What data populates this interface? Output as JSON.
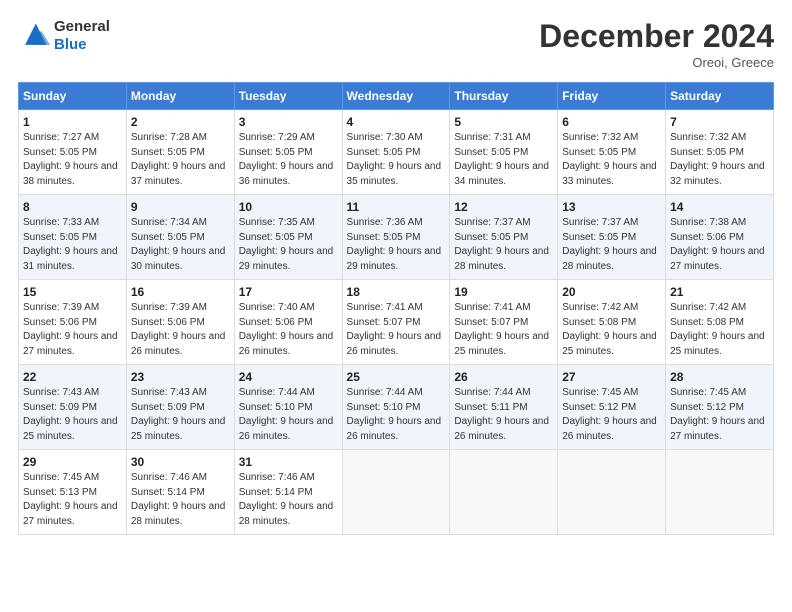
{
  "header": {
    "logo_line1": "General",
    "logo_line2": "Blue",
    "month": "December 2024",
    "location": "Oreoi, Greece"
  },
  "weekdays": [
    "Sunday",
    "Monday",
    "Tuesday",
    "Wednesday",
    "Thursday",
    "Friday",
    "Saturday"
  ],
  "weeks": [
    [
      {
        "day": "1",
        "sunrise": "7:27 AM",
        "sunset": "5:05 PM",
        "daylight": "9 hours and 38 minutes."
      },
      {
        "day": "2",
        "sunrise": "7:28 AM",
        "sunset": "5:05 PM",
        "daylight": "9 hours and 37 minutes."
      },
      {
        "day": "3",
        "sunrise": "7:29 AM",
        "sunset": "5:05 PM",
        "daylight": "9 hours and 36 minutes."
      },
      {
        "day": "4",
        "sunrise": "7:30 AM",
        "sunset": "5:05 PM",
        "daylight": "9 hours and 35 minutes."
      },
      {
        "day": "5",
        "sunrise": "7:31 AM",
        "sunset": "5:05 PM",
        "daylight": "9 hours and 34 minutes."
      },
      {
        "day": "6",
        "sunrise": "7:32 AM",
        "sunset": "5:05 PM",
        "daylight": "9 hours and 33 minutes."
      },
      {
        "day": "7",
        "sunrise": "7:32 AM",
        "sunset": "5:05 PM",
        "daylight": "9 hours and 32 minutes."
      }
    ],
    [
      {
        "day": "8",
        "sunrise": "7:33 AM",
        "sunset": "5:05 PM",
        "daylight": "9 hours and 31 minutes."
      },
      {
        "day": "9",
        "sunrise": "7:34 AM",
        "sunset": "5:05 PM",
        "daylight": "9 hours and 30 minutes."
      },
      {
        "day": "10",
        "sunrise": "7:35 AM",
        "sunset": "5:05 PM",
        "daylight": "9 hours and 29 minutes."
      },
      {
        "day": "11",
        "sunrise": "7:36 AM",
        "sunset": "5:05 PM",
        "daylight": "9 hours and 29 minutes."
      },
      {
        "day": "12",
        "sunrise": "7:37 AM",
        "sunset": "5:05 PM",
        "daylight": "9 hours and 28 minutes."
      },
      {
        "day": "13",
        "sunrise": "7:37 AM",
        "sunset": "5:05 PM",
        "daylight": "9 hours and 28 minutes."
      },
      {
        "day": "14",
        "sunrise": "7:38 AM",
        "sunset": "5:06 PM",
        "daylight": "9 hours and 27 minutes."
      }
    ],
    [
      {
        "day": "15",
        "sunrise": "7:39 AM",
        "sunset": "5:06 PM",
        "daylight": "9 hours and 27 minutes."
      },
      {
        "day": "16",
        "sunrise": "7:39 AM",
        "sunset": "5:06 PM",
        "daylight": "9 hours and 26 minutes."
      },
      {
        "day": "17",
        "sunrise": "7:40 AM",
        "sunset": "5:06 PM",
        "daylight": "9 hours and 26 minutes."
      },
      {
        "day": "18",
        "sunrise": "7:41 AM",
        "sunset": "5:07 PM",
        "daylight": "9 hours and 26 minutes."
      },
      {
        "day": "19",
        "sunrise": "7:41 AM",
        "sunset": "5:07 PM",
        "daylight": "9 hours and 25 minutes."
      },
      {
        "day": "20",
        "sunrise": "7:42 AM",
        "sunset": "5:08 PM",
        "daylight": "9 hours and 25 minutes."
      },
      {
        "day": "21",
        "sunrise": "7:42 AM",
        "sunset": "5:08 PM",
        "daylight": "9 hours and 25 minutes."
      }
    ],
    [
      {
        "day": "22",
        "sunrise": "7:43 AM",
        "sunset": "5:09 PM",
        "daylight": "9 hours and 25 minutes."
      },
      {
        "day": "23",
        "sunrise": "7:43 AM",
        "sunset": "5:09 PM",
        "daylight": "9 hours and 25 minutes."
      },
      {
        "day": "24",
        "sunrise": "7:44 AM",
        "sunset": "5:10 PM",
        "daylight": "9 hours and 26 minutes."
      },
      {
        "day": "25",
        "sunrise": "7:44 AM",
        "sunset": "5:10 PM",
        "daylight": "9 hours and 26 minutes."
      },
      {
        "day": "26",
        "sunrise": "7:44 AM",
        "sunset": "5:11 PM",
        "daylight": "9 hours and 26 minutes."
      },
      {
        "day": "27",
        "sunrise": "7:45 AM",
        "sunset": "5:12 PM",
        "daylight": "9 hours and 26 minutes."
      },
      {
        "day": "28",
        "sunrise": "7:45 AM",
        "sunset": "5:12 PM",
        "daylight": "9 hours and 27 minutes."
      }
    ],
    [
      {
        "day": "29",
        "sunrise": "7:45 AM",
        "sunset": "5:13 PM",
        "daylight": "9 hours and 27 minutes."
      },
      {
        "day": "30",
        "sunrise": "7:46 AM",
        "sunset": "5:14 PM",
        "daylight": "9 hours and 28 minutes."
      },
      {
        "day": "31",
        "sunrise": "7:46 AM",
        "sunset": "5:14 PM",
        "daylight": "9 hours and 28 minutes."
      },
      null,
      null,
      null,
      null
    ]
  ]
}
